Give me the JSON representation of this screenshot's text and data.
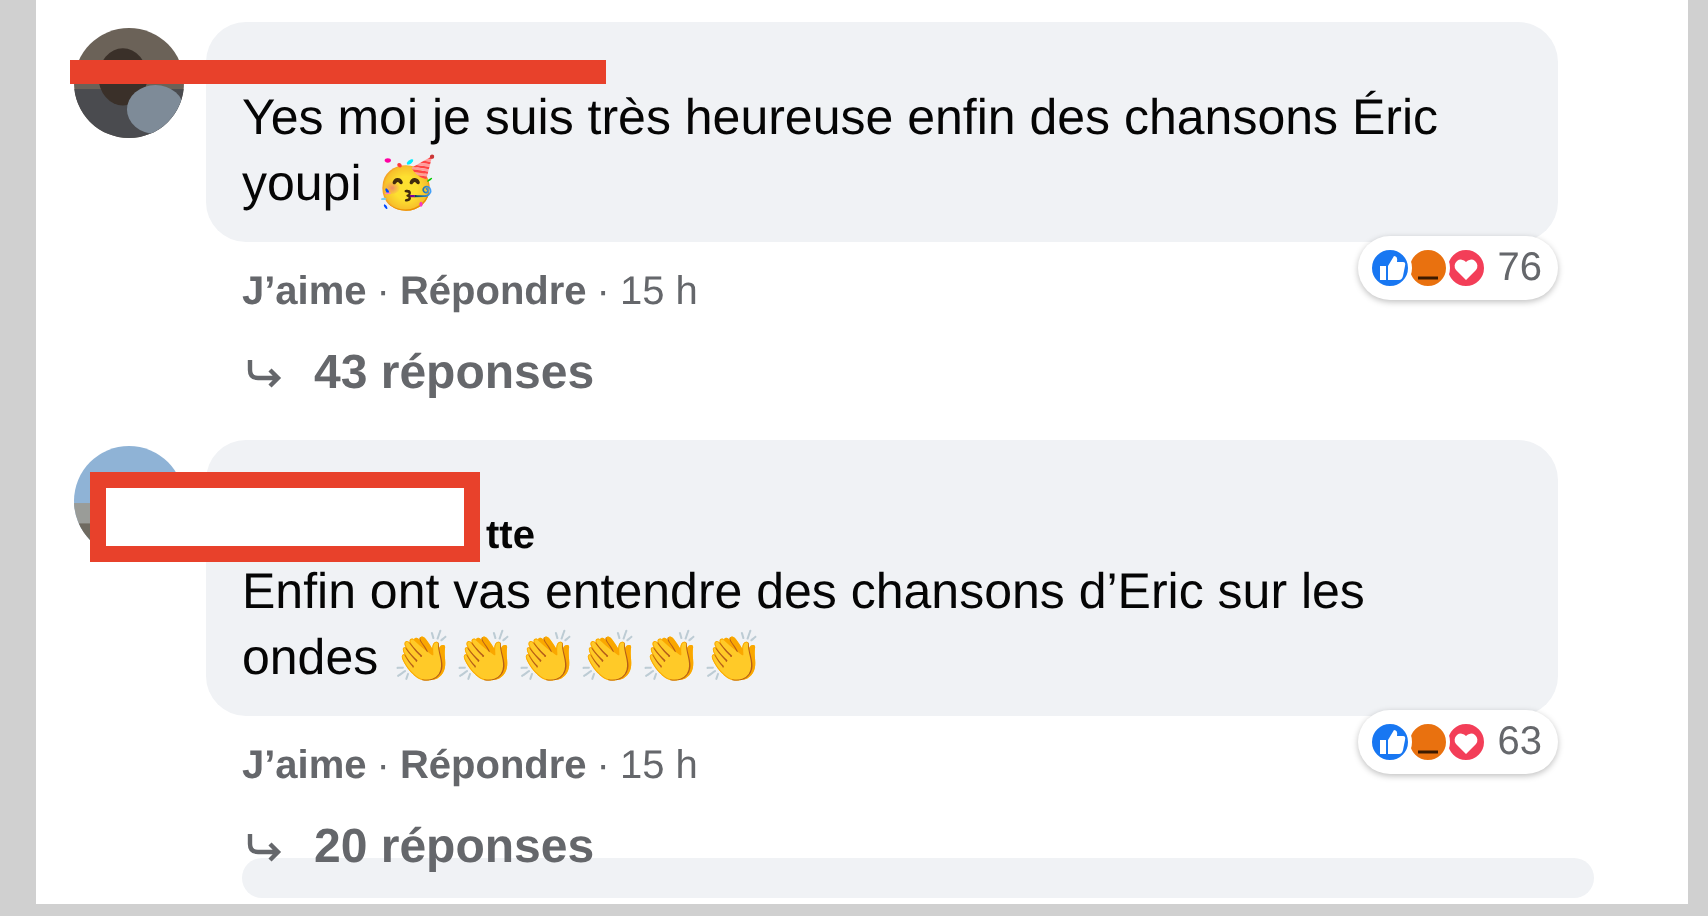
{
  "comments": [
    {
      "text": "Yes moi je suis très heureuse enfin des chansons Éric youpi 🥳",
      "reactions_count": "76",
      "actions": [
        "J’aime",
        "Répondre"
      ],
      "separator": "·",
      "time": "15 h",
      "replies": "43 réponses"
    },
    {
      "name_visible": "tte",
      "text": "Enfin ont vas entendre des chansons d’Eric sur les ondes 👏👏👏👏👏👏",
      "reactions_count": "63",
      "actions": [
        "J’aime",
        "Répondre"
      ],
      "separator": "·",
      "time": "15 h",
      "replies": "20 réponses"
    }
  ]
}
